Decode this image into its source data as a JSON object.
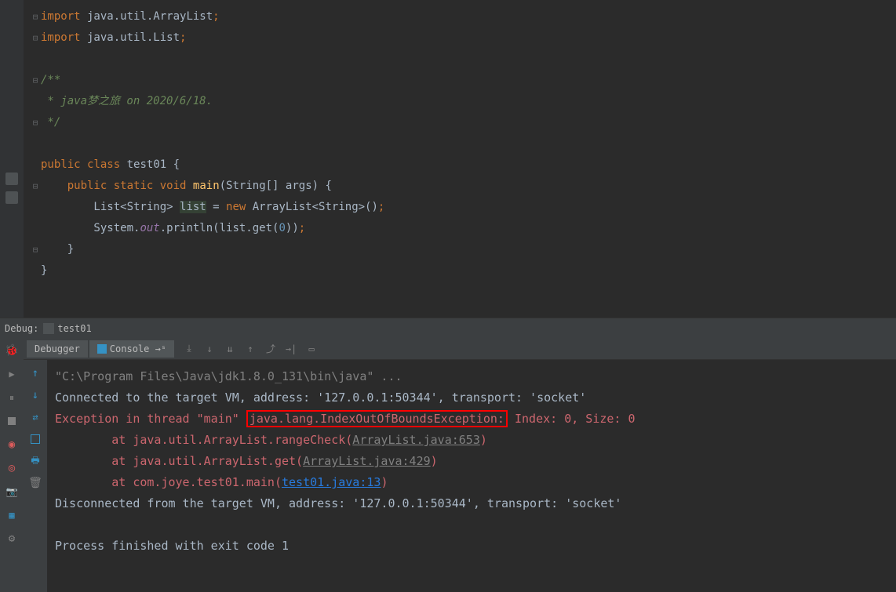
{
  "code": {
    "line1_import": "import",
    "line1_rest": " java.util.ArrayList",
    "line2_import": "import",
    "line2_rest": " java.util.List",
    "comment_start": "/**",
    "comment_body": " * java梦之旅 on 2020/6/18.",
    "comment_end": " */",
    "public": "public",
    "class": "class",
    "classname": " test01 {",
    "static": "static",
    "void": "void",
    "main": "main",
    "main_params": "(String[] args) {",
    "list_decl_1": "        List<String> ",
    "list_var": "list",
    "list_decl_2": " = ",
    "new": "new",
    "list_decl_3": " ArrayList<String>()",
    "println_1": "        System.",
    "out": "out",
    "println_2": ".println(list.get(",
    "zero": "0",
    "println_3": "))",
    "close1": "    }",
    "close2": "}"
  },
  "debugbar": {
    "label_debug": "Debug:",
    "label_test": "test01"
  },
  "tabs": {
    "debugger": "Debugger",
    "console": "Console"
  },
  "console": {
    "l1": "\"C:\\Program Files\\Java\\jdk1.8.0_131\\bin\\java\" ...",
    "l2": "Connected to the target VM, address: '127.0.0.1:50344', transport: 'socket'",
    "l3_a": "Exception in thread \"main\" ",
    "l3_box": "java.lang.IndexOutOfBoundsException:",
    "l3_c": " Index: 0, Size: 0",
    "l4_a": "\tat java.util.ArrayList.rangeCheck(",
    "l4_link": "ArrayList.java:653",
    "l4_b": ")",
    "l5_a": "\tat java.util.ArrayList.get(",
    "l5_link": "ArrayList.java:429",
    "l5_b": ")",
    "l6_a": "\tat com.joye.test01.main(",
    "l6_link": "test01.java:13",
    "l6_b": ")",
    "l7": "Disconnected from the target VM, address: '127.0.0.1:50344', transport: 'socket'",
    "l8": "Process finished with exit code 1"
  }
}
